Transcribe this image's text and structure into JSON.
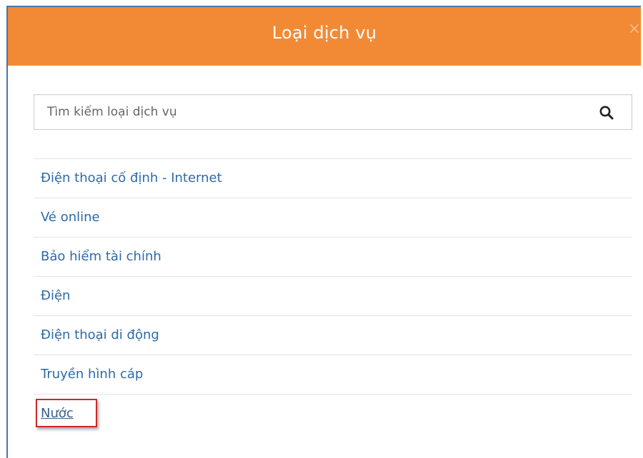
{
  "dialog": {
    "title": "Loại dịch vụ",
    "close_glyph": "×"
  },
  "search": {
    "placeholder": "Tìm kiếm loại dịch vụ",
    "value": "",
    "icon": "search-icon"
  },
  "services": [
    {
      "label": "Điện thoại cố định - Internet"
    },
    {
      "label": "Vé online"
    },
    {
      "label": "Bảo hiểm tài chính"
    },
    {
      "label": "Điện"
    },
    {
      "label": "Điện thoại di động"
    },
    {
      "label": "Truyền hình cáp"
    },
    {
      "label": "Nước",
      "highlighted": true
    }
  ],
  "colors": {
    "header": "#f28a35",
    "link": "#2d6aa8",
    "highlight_border": "#c92a2a",
    "frame_border": "#4a74a8"
  }
}
